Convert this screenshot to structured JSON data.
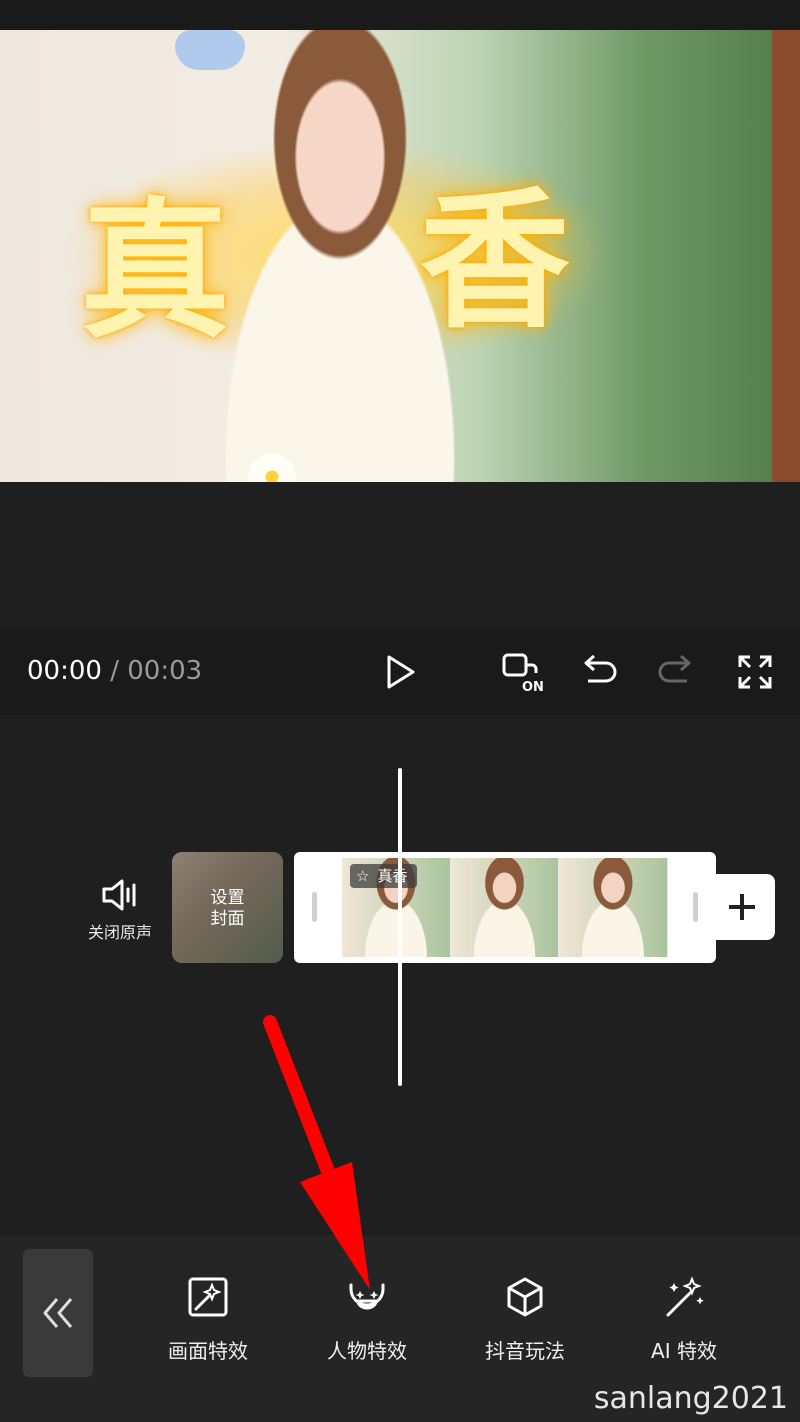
{
  "preview": {
    "overlay_text": [
      "真",
      "香"
    ]
  },
  "controls": {
    "current_time": "00:00",
    "separator": "/",
    "total_time": "00:03",
    "hd_badge": "ON"
  },
  "timeline": {
    "mute_label": "关闭原声",
    "cover_label": "设置\n封面",
    "effect_tag": "真香"
  },
  "toolbar": {
    "items": [
      {
        "label": "画面特效",
        "icon": "image-effect-icon"
      },
      {
        "label": "人物特效",
        "icon": "face-effect-icon"
      },
      {
        "label": "抖音玩法",
        "icon": "cube-icon"
      },
      {
        "label": "AI 特效",
        "icon": "magic-wand-icon"
      }
    ]
  },
  "annotation": {
    "arrow_color": "#ff0000"
  },
  "watermark": "sanlang2021"
}
